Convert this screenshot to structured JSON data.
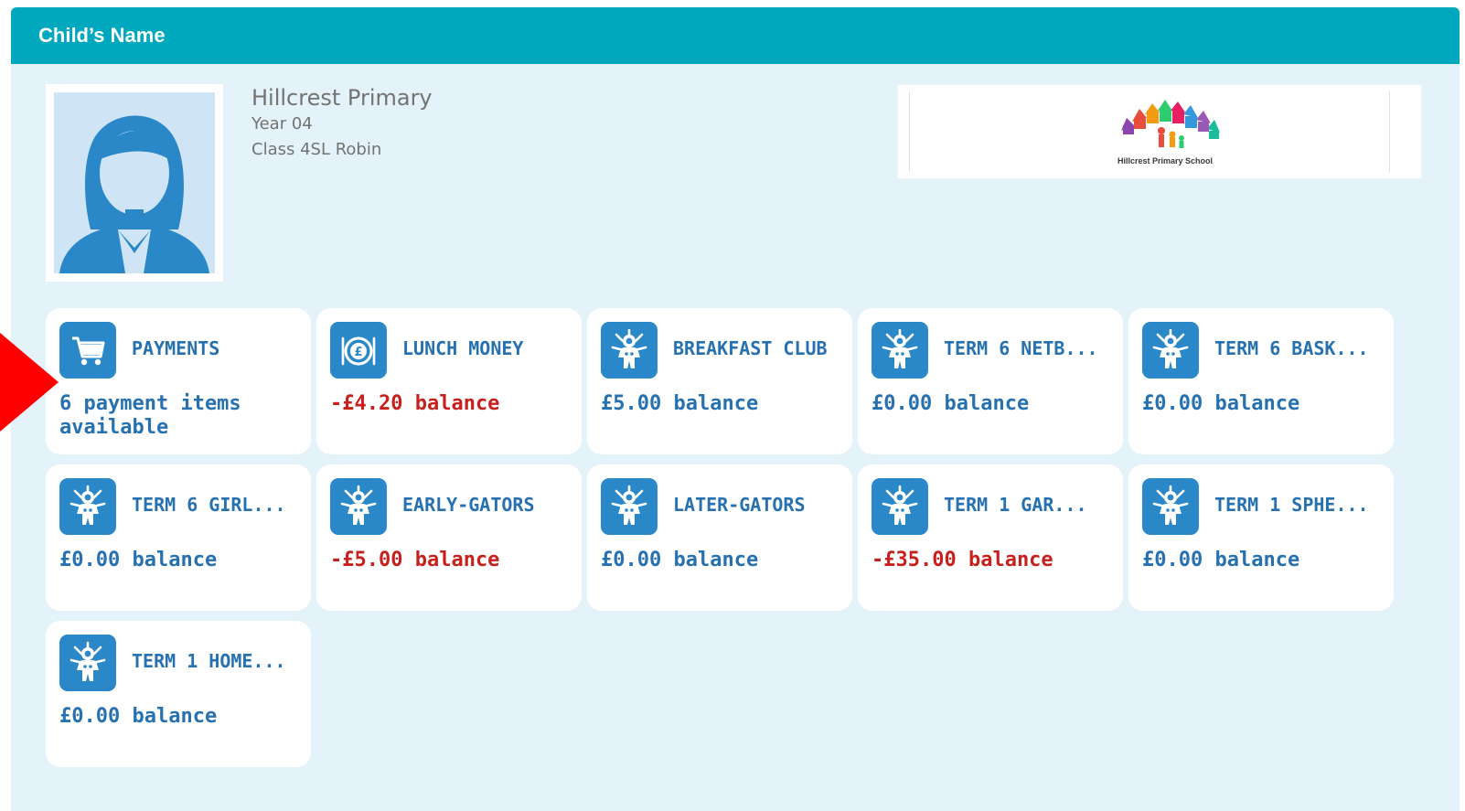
{
  "header": {
    "title": "Child’s Name"
  },
  "profile": {
    "school_name": "Hillcrest Primary",
    "year": "Year 04",
    "class": "Class 4SL Robin"
  },
  "logo": {
    "caption": "Hillcrest Primary School"
  },
  "colors": {
    "header_bg": "#00a8bd",
    "panel_bg": "#e4f3f9",
    "icon_bg": "#2b88c8",
    "title_text": "#2771b0",
    "negative_balance": "#c8211d",
    "annotation_arrow": "#ff0000"
  },
  "tiles": [
    {
      "icon": "shopping-cart-icon",
      "title": "PAYMENTS",
      "info": "6 payment items available",
      "negative": false
    },
    {
      "icon": "pound-coin-plate-icon",
      "title": "LUNCH MONEY",
      "info": "-£4.20 balance",
      "negative": true
    },
    {
      "icon": "child-figure-icon",
      "title": "BREAKFAST CLUB",
      "info": "£5.00 balance",
      "negative": false
    },
    {
      "icon": "child-figure-icon",
      "title": "TERM 6 NETB...",
      "info": "£0.00 balance",
      "negative": false
    },
    {
      "icon": "child-figure-icon",
      "title": "TERM 6 BASK...",
      "info": "£0.00 balance",
      "negative": false
    },
    {
      "icon": "child-figure-icon",
      "title": "TERM 6 GIRL...",
      "info": "£0.00 balance",
      "negative": false
    },
    {
      "icon": "child-figure-icon",
      "title": "EARLY-GATORS",
      "info": "-£5.00 balance",
      "negative": true
    },
    {
      "icon": "child-figure-icon",
      "title": "LATER-GATORS",
      "info": "£0.00 balance",
      "negative": false
    },
    {
      "icon": "child-figure-icon",
      "title": "TERM 1 GAR...",
      "info": "-£35.00 balance",
      "negative": true
    },
    {
      "icon": "child-figure-icon",
      "title": "TERM 1 SPHE...",
      "info": "£0.00 balance",
      "negative": false
    },
    {
      "icon": "child-figure-icon",
      "title": "TERM 1 HOME...",
      "info": "£0.00 balance",
      "negative": false
    }
  ]
}
